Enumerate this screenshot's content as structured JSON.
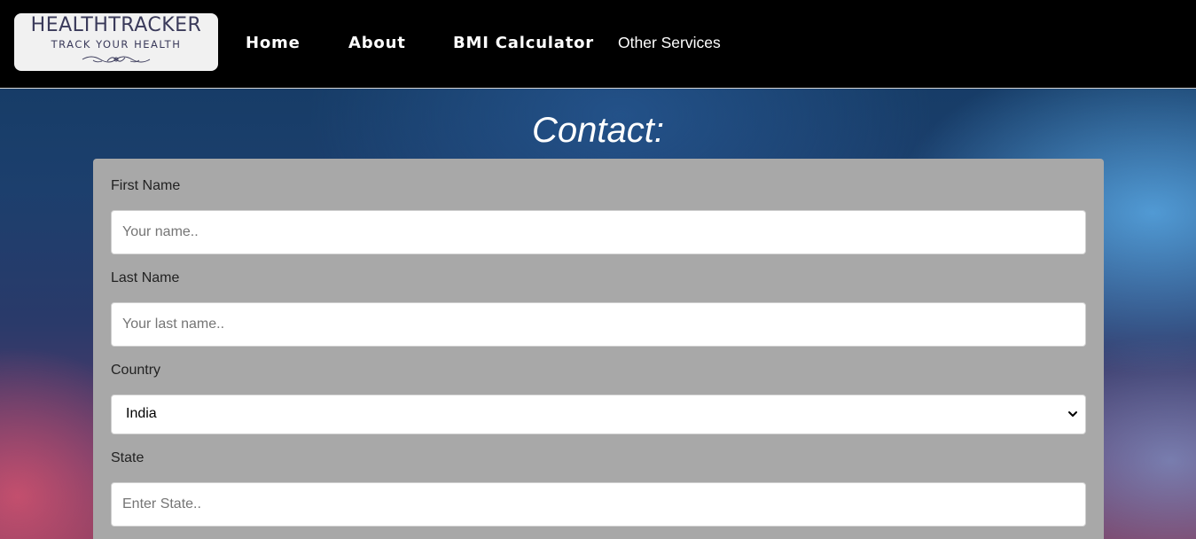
{
  "brand": {
    "title": "HEALTHTRACKER",
    "tagline": "TRACK YOUR HEALTH"
  },
  "nav": {
    "items": [
      {
        "label": "Home"
      },
      {
        "label": "About"
      },
      {
        "label": "BMI Calculator"
      },
      {
        "label": "Other Services"
      }
    ]
  },
  "page": {
    "title": "Contact:"
  },
  "form": {
    "first_name": {
      "label": "First Name",
      "placeholder": "Your name.."
    },
    "last_name": {
      "label": "Last Name",
      "placeholder": "Your last name.."
    },
    "country": {
      "label": "Country",
      "value": "India"
    },
    "state": {
      "label": "State",
      "placeholder": "Enter State.."
    }
  },
  "colors": {
    "navbar_bg": "#000000",
    "card_bg": "#a8a8a8",
    "nav_text": "#ffffff"
  }
}
